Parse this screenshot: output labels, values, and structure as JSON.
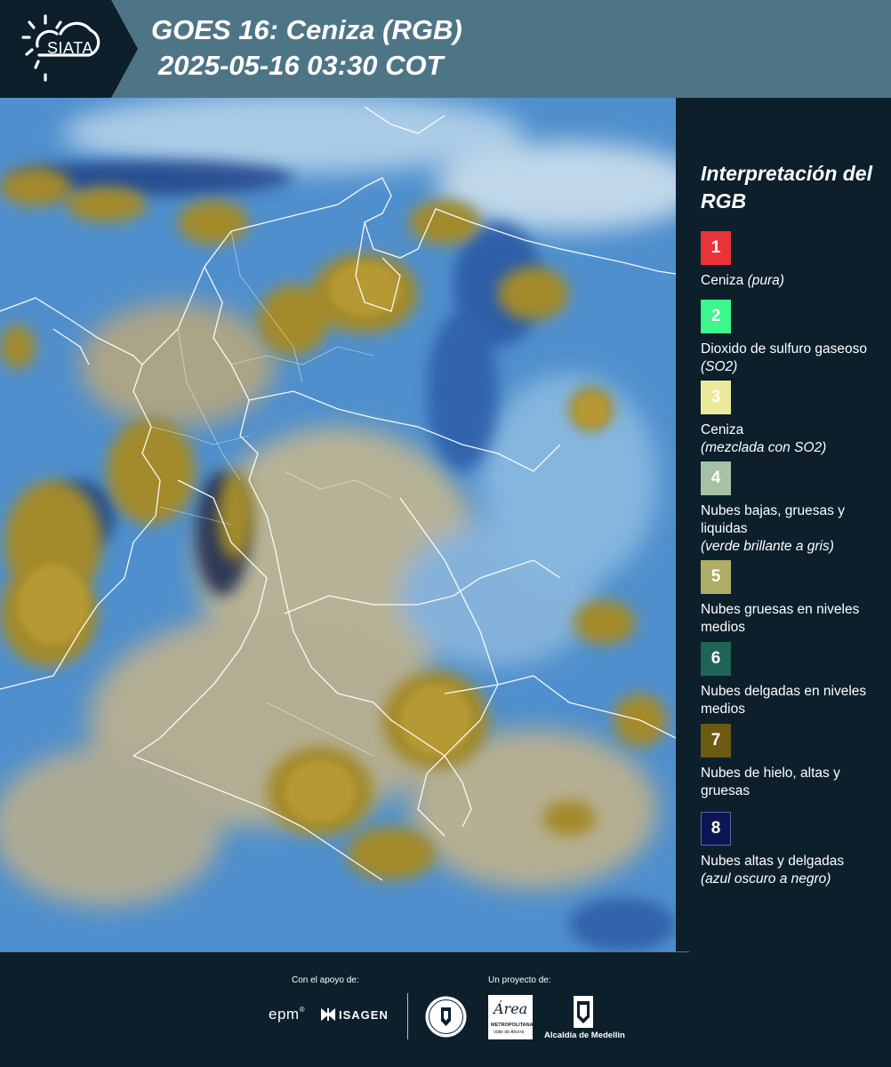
{
  "header": {
    "logo_text": "SIATA",
    "title_line1": "GOES 16: Ceniza (RGB)",
    "title_line2": "2025-05-16 03:30 COT",
    "bg_color": "#4e7586",
    "logo_bg_color": "#0c1f2b"
  },
  "legend": {
    "title": "Interpretación del RGB",
    "items": [
      {
        "num": "1",
        "color": "#ea3338",
        "label": "Ceniza",
        "note": "(pura)"
      },
      {
        "num": "2",
        "color": "#3cf88c",
        "label": "Dioxido de sulfuro gaseoso",
        "note": "(SO2)"
      },
      {
        "num": "3",
        "color": "#ece99a",
        "label": "Ceniza",
        "note": "(mezclada con SO2)"
      },
      {
        "num": "4",
        "color": "#a5c1a6",
        "label": "Nubes bajas, gruesas y liquidas",
        "note": "(verde brillante a gris)"
      },
      {
        "num": "5",
        "color": "#adad67",
        "label": "Nubes gruesas en niveles medios",
        "note": ""
      },
      {
        "num": "6",
        "color": "#1f6557",
        "label": "Nubes delgadas en niveles medios",
        "note": ""
      },
      {
        "num": "7",
        "color": "#6c5a12",
        "label": "Nubes de hielo, altas y gruesas",
        "note": ""
      },
      {
        "num": "8",
        "color": "#0c1654",
        "label": "Nubes altas y delgadas",
        "note": "(azul oscuro a negro)"
      }
    ]
  },
  "footer": {
    "support_label": "Con el apoyo de:",
    "project_label": "Un proyecto de:",
    "epm": "epm",
    "isagen": "ISAGEN",
    "area_line1": "Área",
    "area_line2": "METROPOLITANA",
    "area_line3": "Valle de Aburrá",
    "alcaldia": "Alcaldía de Medellín"
  }
}
